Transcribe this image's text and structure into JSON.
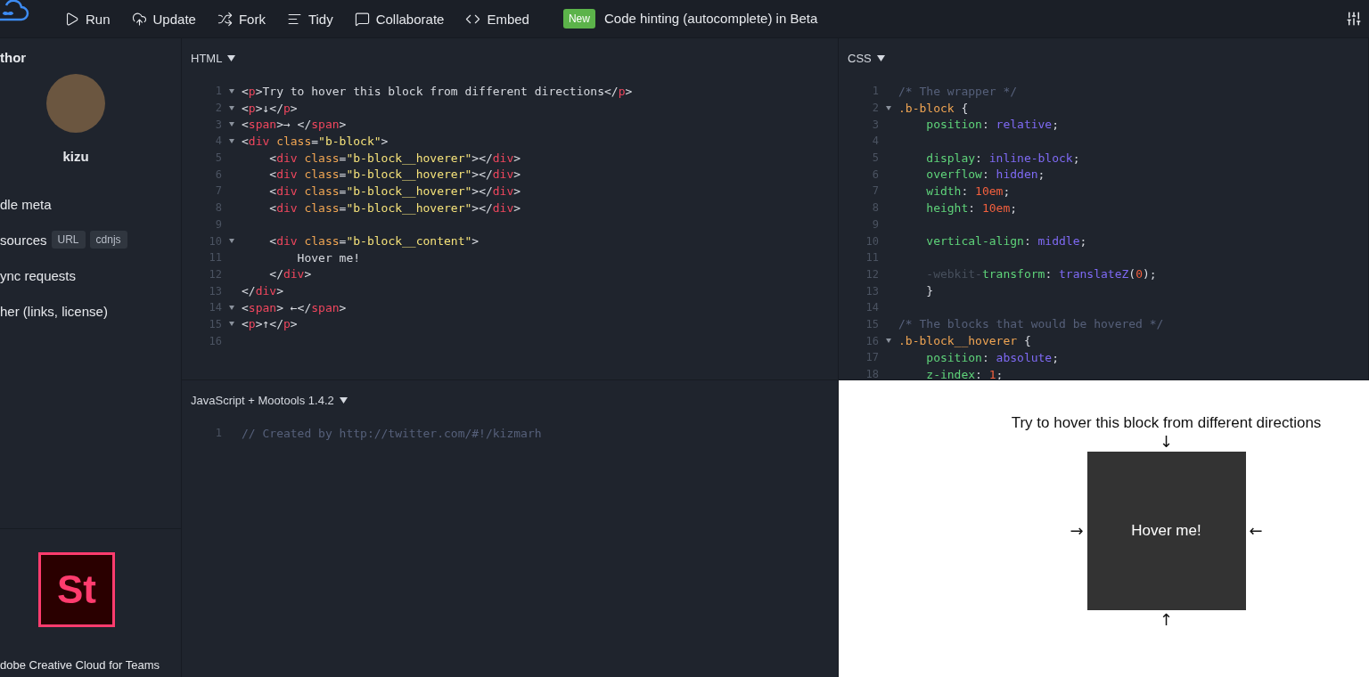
{
  "toolbar": {
    "actions": [
      {
        "kind": "run",
        "label": "Run"
      },
      {
        "kind": "update",
        "label": "Update"
      },
      {
        "kind": "fork",
        "label": "Fork"
      },
      {
        "kind": "tidy",
        "label": "Tidy"
      },
      {
        "kind": "collaborate",
        "label": "Collaborate"
      },
      {
        "kind": "embed",
        "label": "Embed"
      }
    ],
    "badge": "New",
    "notice": "Code hinting (autocomplete) in Beta"
  },
  "sidebar": {
    "heading": "thor",
    "author": "kizu",
    "items": [
      {
        "label": "dle meta"
      },
      {
        "label": "sources",
        "tags": [
          "URL",
          "cdnjs"
        ]
      },
      {
        "label": "ync requests"
      },
      {
        "label": "her (links, license)"
      }
    ],
    "ad": {
      "logo": "St",
      "text": "dobe Creative Cloud for Teams"
    }
  },
  "panels": [
    {
      "title": "HTML",
      "lines": [
        {
          "n": "1",
          "fold": true,
          "tokens": [
            {
              "kind": "plain",
              "text": "<"
            },
            {
              "kind": "tag",
              "text": "p"
            },
            {
              "kind": "plain",
              "text": ">Try to hover this block from different directions</"
            },
            {
              "kind": "tag",
              "text": "p"
            },
            {
              "kind": "plain",
              "text": ">"
            }
          ]
        },
        {
          "n": "2",
          "fold": true,
          "tokens": [
            {
              "kind": "plain",
              "text": "<"
            },
            {
              "kind": "tag",
              "text": "p"
            },
            {
              "kind": "plain",
              "text": ">↓</"
            },
            {
              "kind": "tag",
              "text": "p"
            },
            {
              "kind": "plain",
              "text": ">"
            }
          ]
        },
        {
          "n": "3",
          "fold": true,
          "tokens": [
            {
              "kind": "plain",
              "text": "<"
            },
            {
              "kind": "tag",
              "text": "span"
            },
            {
              "kind": "plain",
              "text": ">→ </"
            },
            {
              "kind": "tag",
              "text": "span"
            },
            {
              "kind": "plain",
              "text": ">"
            }
          ]
        },
        {
          "n": "4",
          "fold": true,
          "tokens": [
            {
              "kind": "plain",
              "text": "<"
            },
            {
              "kind": "tag",
              "text": "div"
            },
            {
              "kind": "attr",
              "text": " class"
            },
            {
              "kind": "plain",
              "text": "="
            },
            {
              "kind": "string",
              "text": "\"b-block\""
            },
            {
              "kind": "plain",
              "text": ">"
            }
          ]
        },
        {
          "n": "5",
          "fold": false,
          "tokens": [
            {
              "kind": "plain",
              "text": "    <"
            },
            {
              "kind": "tag",
              "text": "div"
            },
            {
              "kind": "attr",
              "text": " class"
            },
            {
              "kind": "plain",
              "text": "="
            },
            {
              "kind": "string",
              "text": "\"b-block__hoverer\""
            },
            {
              "kind": "plain",
              "text": "></"
            },
            {
              "kind": "tag",
              "text": "div"
            },
            {
              "kind": "plain",
              "text": ">"
            }
          ]
        },
        {
          "n": "6",
          "fold": false,
          "tokens": [
            {
              "kind": "plain",
              "text": "    <"
            },
            {
              "kind": "tag",
              "text": "div"
            },
            {
              "kind": "attr",
              "text": " class"
            },
            {
              "kind": "plain",
              "text": "="
            },
            {
              "kind": "string",
              "text": "\"b-block__hoverer\""
            },
            {
              "kind": "plain",
              "text": "></"
            },
            {
              "kind": "tag",
              "text": "div"
            },
            {
              "kind": "plain",
              "text": ">"
            }
          ]
        },
        {
          "n": "7",
          "fold": false,
          "tokens": [
            {
              "kind": "plain",
              "text": "    <"
            },
            {
              "kind": "tag",
              "text": "div"
            },
            {
              "kind": "attr",
              "text": " class"
            },
            {
              "kind": "plain",
              "text": "="
            },
            {
              "kind": "string",
              "text": "\"b-block__hoverer\""
            },
            {
              "kind": "plain",
              "text": "></"
            },
            {
              "kind": "tag",
              "text": "div"
            },
            {
              "kind": "plain",
              "text": ">"
            }
          ]
        },
        {
          "n": "8",
          "fold": false,
          "tokens": [
            {
              "kind": "plain",
              "text": "    <"
            },
            {
              "kind": "tag",
              "text": "div"
            },
            {
              "kind": "attr",
              "text": " class"
            },
            {
              "kind": "plain",
              "text": "="
            },
            {
              "kind": "string",
              "text": "\"b-block__hoverer\""
            },
            {
              "kind": "plain",
              "text": "></"
            },
            {
              "kind": "tag",
              "text": "div"
            },
            {
              "kind": "plain",
              "text": ">"
            }
          ]
        },
        {
          "n": "9",
          "fold": false
        },
        {
          "n": "10",
          "fold": true,
          "tokens": [
            {
              "kind": "plain",
              "text": "    <"
            },
            {
              "kind": "tag",
              "text": "div"
            },
            {
              "kind": "attr",
              "text": " class"
            },
            {
              "kind": "plain",
              "text": "="
            },
            {
              "kind": "string",
              "text": "\"b-block__content\""
            },
            {
              "kind": "plain",
              "text": ">"
            }
          ]
        },
        {
          "n": "11",
          "fold": false,
          "tokens": [
            {
              "kind": "plain",
              "text": "        Hover me!"
            }
          ]
        },
        {
          "n": "12",
          "fold": false,
          "tokens": [
            {
              "kind": "plain",
              "text": "    </"
            },
            {
              "kind": "tag",
              "text": "div"
            },
            {
              "kind": "plain",
              "text": ">"
            }
          ]
        },
        {
          "n": "13",
          "fold": false,
          "tokens": [
            {
              "kind": "plain",
              "text": "</"
            },
            {
              "kind": "tag",
              "text": "div"
            },
            {
              "kind": "plain",
              "text": ">"
            }
          ]
        },
        {
          "n": "14",
          "fold": true,
          "tokens": [
            {
              "kind": "plain",
              "text": "<"
            },
            {
              "kind": "tag",
              "text": "span"
            },
            {
              "kind": "plain",
              "text": "> ←</"
            },
            {
              "kind": "tag",
              "text": "span"
            },
            {
              "kind": "plain",
              "text": ">"
            }
          ]
        },
        {
          "n": "15",
          "fold": true,
          "tokens": [
            {
              "kind": "plain",
              "text": "<"
            },
            {
              "kind": "tag",
              "text": "p"
            },
            {
              "kind": "plain",
              "text": ">↑</"
            },
            {
              "kind": "tag",
              "text": "p"
            },
            {
              "kind": "plain",
              "text": ">"
            }
          ]
        },
        {
          "n": "16",
          "fold": false
        }
      ]
    },
    {
      "title": "CSS",
      "lines": [
        {
          "n": "1",
          "fold": false,
          "tokens": [
            {
              "kind": "comment",
              "text": "/* The wrapper */"
            }
          ]
        },
        {
          "n": "2",
          "fold": true,
          "tokens": [
            {
              "kind": "selector",
              "text": ".b-block"
            },
            {
              "kind": "plain",
              "text": " {"
            }
          ]
        },
        {
          "n": "3",
          "fold": false,
          "tokens": [
            {
              "kind": "property",
              "text": "    position"
            },
            {
              "kind": "plain",
              "text": ": "
            },
            {
              "kind": "value",
              "text": "relative"
            },
            {
              "kind": "plain",
              "text": ";"
            }
          ]
        },
        {
          "n": "4",
          "fold": false
        },
        {
          "n": "5",
          "fold": false,
          "tokens": [
            {
              "kind": "property",
              "text": "    display"
            },
            {
              "kind": "plain",
              "text": ": "
            },
            {
              "kind": "value",
              "text": "inline-block"
            },
            {
              "kind": "plain",
              "text": ";"
            }
          ]
        },
        {
          "n": "6",
          "fold": false,
          "tokens": [
            {
              "kind": "property",
              "text": "    overflow"
            },
            {
              "kind": "plain",
              "text": ": "
            },
            {
              "kind": "value",
              "text": "hidden"
            },
            {
              "kind": "plain",
              "text": ";"
            }
          ]
        },
        {
          "n": "7",
          "fold": false,
          "tokens": [
            {
              "kind": "property",
              "text": "    width"
            },
            {
              "kind": "plain",
              "text": ": "
            },
            {
              "kind": "number",
              "text": "10em"
            },
            {
              "kind": "plain",
              "text": ";"
            }
          ]
        },
        {
          "n": "8",
          "fold": false,
          "tokens": [
            {
              "kind": "property",
              "text": "    height"
            },
            {
              "kind": "plain",
              "text": ": "
            },
            {
              "kind": "number",
              "text": "10em"
            },
            {
              "kind": "plain",
              "text": ";"
            }
          ]
        },
        {
          "n": "9",
          "fold": false
        },
        {
          "n": "10",
          "fold": false,
          "tokens": [
            {
              "kind": "property",
              "text": "    vertical-align"
            },
            {
              "kind": "plain",
              "text": ": "
            },
            {
              "kind": "value",
              "text": "middle"
            },
            {
              "kind": "plain",
              "text": ";"
            }
          ]
        },
        {
          "n": "11",
          "fold": false
        },
        {
          "n": "12",
          "fold": false,
          "tokens": [
            {
              "kind": "vendor",
              "text": "    -webkit-"
            },
            {
              "kind": "property",
              "text": "transform"
            },
            {
              "kind": "plain",
              "text": ": "
            },
            {
              "kind": "value",
              "text": "translateZ"
            },
            {
              "kind": "plain",
              "text": "("
            },
            {
              "kind": "number",
              "text": "0"
            },
            {
              "kind": "plain",
              "text": ");"
            }
          ]
        },
        {
          "n": "13",
          "fold": false,
          "tokens": [
            {
              "kind": "plain",
              "text": "    }"
            }
          ]
        },
        {
          "n": "14",
          "fold": false
        },
        {
          "n": "15",
          "fold": false,
          "tokens": [
            {
              "kind": "comment",
              "text": "/* The blocks that would be hovered */"
            }
          ]
        },
        {
          "n": "16",
          "fold": true,
          "tokens": [
            {
              "kind": "selector",
              "text": ".b-block__hoverer"
            },
            {
              "kind": "plain",
              "text": " {"
            }
          ]
        },
        {
          "n": "17",
          "fold": false,
          "tokens": [
            {
              "kind": "property",
              "text": "    position"
            },
            {
              "kind": "plain",
              "text": ": "
            },
            {
              "kind": "value",
              "text": "absolute"
            },
            {
              "kind": "plain",
              "text": ";"
            }
          ]
        },
        {
          "n": "18",
          "fold": false,
          "tokens": [
            {
              "kind": "property",
              "text": "    z-index"
            },
            {
              "kind": "plain",
              "text": ": "
            },
            {
              "kind": "number",
              "text": "1"
            },
            {
              "kind": "plain",
              "text": ";"
            }
          ]
        }
      ]
    },
    {
      "title": "JavaScript + Mootools 1.4.2",
      "lines": [
        {
          "n": "1",
          "fold": false,
          "tokens": [
            {
              "kind": "comment",
              "text": "// Created by http://twitter.com/#!/kizmarh"
            }
          ]
        }
      ]
    }
  ],
  "result": {
    "heading": "Try to hover this block from different directions",
    "arrow_top": "↓",
    "arrow_left": "→",
    "block": "Hover me!",
    "arrow_right": "←",
    "arrow_bottom": "↑"
  }
}
